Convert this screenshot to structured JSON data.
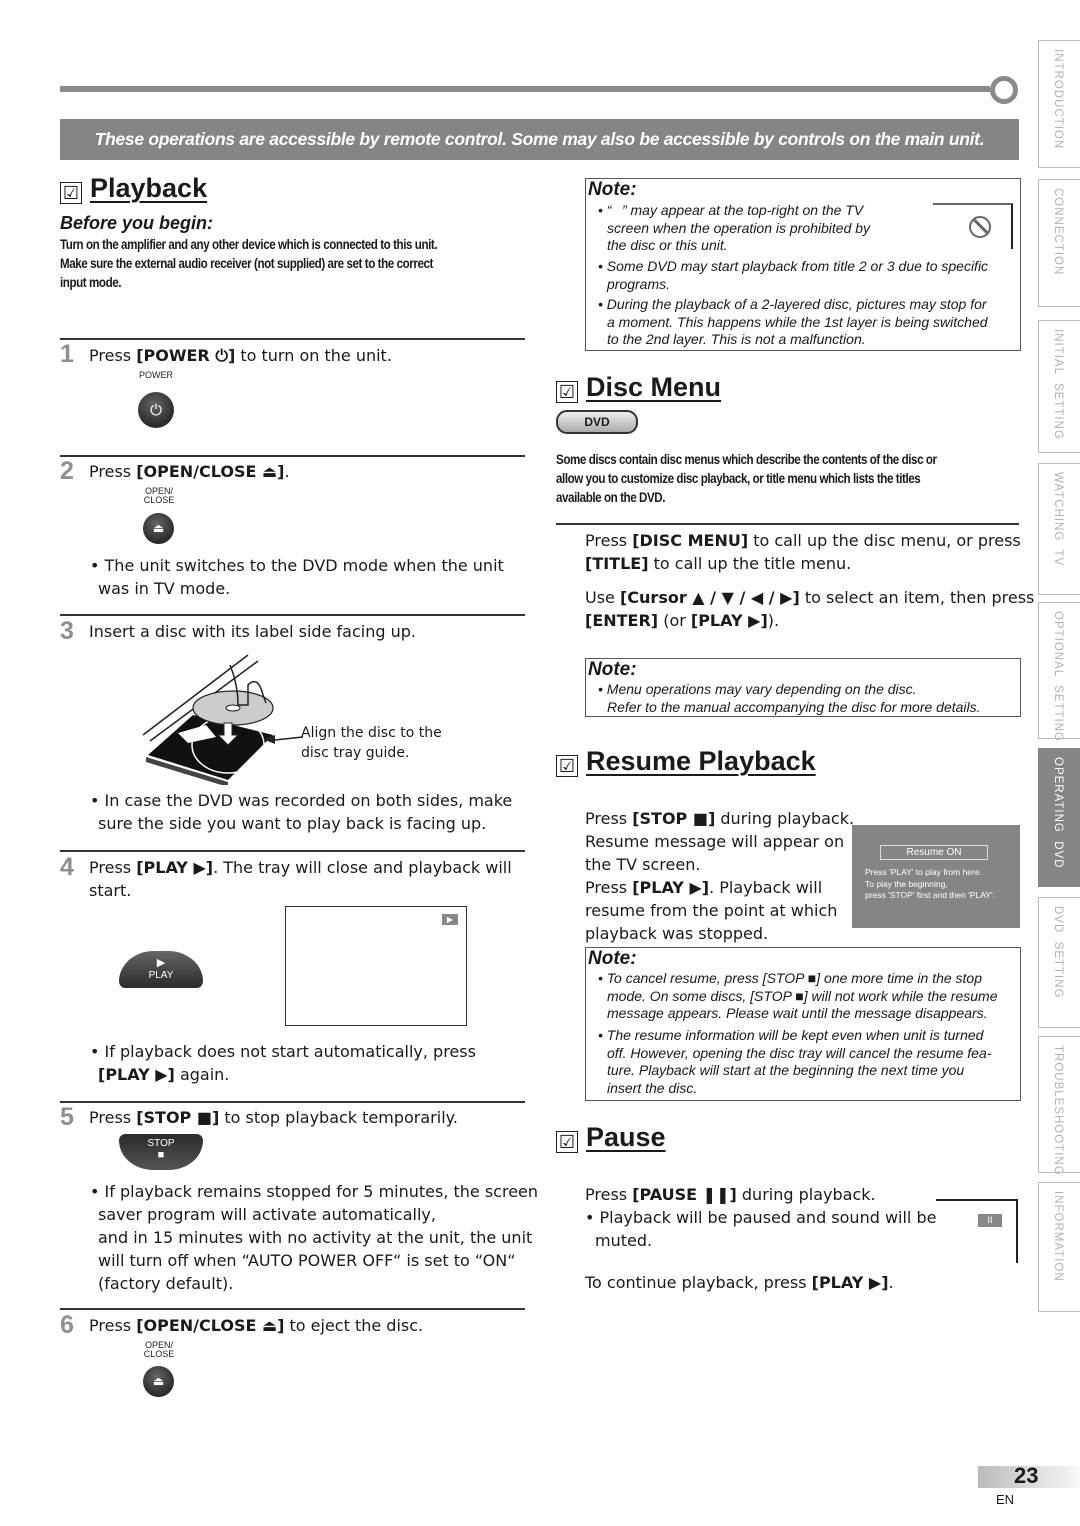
{
  "banner": "These operations are accessible by remote control. Some may also be accessible by controls on the main unit.",
  "side_tabs": [
    {
      "label": "INTRODUCTION",
      "active": false
    },
    {
      "label": "CONNECTION",
      "active": false
    },
    {
      "label": "INITIAL  SETTING",
      "active": false
    },
    {
      "label": "WATCHING  TV",
      "active": false
    },
    {
      "label": "OPTIONAL  SETTING",
      "active": false
    },
    {
      "label": "OPERATING  DVD",
      "active": true
    },
    {
      "label": "DVD  SETTING",
      "active": false
    },
    {
      "label": "TROUBLESHOOTING",
      "active": false
    },
    {
      "label": "INFORMATION",
      "active": false
    }
  ],
  "checkbox_glyph": "☑",
  "playback": {
    "title": "Playback",
    "before_you_begin": "Before you begin:",
    "before_text": [
      "Turn on the amplifier and any other device which is connected to this unit.",
      "Make sure the external audio receiver (not supplied) are set to the correct",
      "input mode."
    ],
    "steps": [
      {
        "num": "1",
        "pre": "Press ",
        "key": "[POWER ⏻]",
        "post": " to turn on the unit.",
        "button_label": "POWER",
        "button_icon": "⏻"
      },
      {
        "num": "2",
        "pre": "Press ",
        "key": "[OPEN/CLOSE ⏏]",
        "post": ".",
        "button_label_1": "OPEN/",
        "button_label_2": "CLOSE",
        "button_icon": "⏏",
        "bullet_1": "• The unit switches to the DVD mode when the unit",
        "bullet_2": "was in TV mode."
      },
      {
        "num": "3",
        "text": "Insert a disc with its label side facing up.",
        "callout_1": "Align the disc to the",
        "callout_2": "disc tray guide.",
        "bullet_1": "• In case the DVD was recorded on both sides, make",
        "bullet_2": "sure the side you want to play back is facing up."
      },
      {
        "num": "4",
        "pre": "Press ",
        "key": "[PLAY ▶]",
        "post": ". The tray will close and playback will",
        "line2": "start.",
        "button_label": "PLAY",
        "button_icon": "▶",
        "screen_icon": "▶",
        "bullet_1": "• If playback does not start automatically, press",
        "bullet_2_key": "[PLAY ▶]",
        "bullet_2_post": " again."
      },
      {
        "num": "5",
        "pre": "Press ",
        "key": "[STOP ■]",
        "post": " to stop playback temporarily.",
        "button_label": "STOP",
        "button_icon": "■",
        "bullet_lines": [
          "• If playback remains stopped for 5 minutes, the screen",
          "saver program will activate automatically,",
          "and in 15 minutes with no activity at the unit, the unit",
          "will turn off when “AUTO POWER OFF“ is set to “ON“",
          "(factory default)."
        ]
      },
      {
        "num": "6",
        "pre": "Press ",
        "key": "[OPEN/CLOSE ⏏]",
        "post": " to eject the disc.",
        "button_label_1": "OPEN/",
        "button_label_2": "CLOSE",
        "button_icon": "⏏"
      }
    ]
  },
  "note1": {
    "title": "Note:",
    "lines": [
      "• “⃠” may appear at the top-right on the TV",
      "screen when the operation is prohibited by",
      "the disc or this unit.",
      "• Some DVD may start playback from title 2 or 3 due to specific",
      "programs.",
      "• During the playback of a 2-layered disc, pictures may stop for",
      "a moment. This happens while the 1st layer is being switched",
      "to the 2nd layer. This is not a malfunction."
    ],
    "prohibited_icon": "⃠"
  },
  "disc_menu": {
    "title": "Disc Menu",
    "badge": "DVD",
    "intro": [
      "Some discs contain disc menus which describe the contents of the disc or",
      "allow you to customize disc playback, or title menu which lists the titles",
      "available on the DVD."
    ],
    "p1_key1": "[DISC MENU]",
    "p1_mid": " to call up the disc menu, or press",
    "p1_key2": "[TITLE]",
    "p1_end": " to call up the title menu.",
    "p2_pre": "Use ",
    "p2_key": "[Cursor ▲ / ▼ / ◀ / ▶]",
    "p2_mid": " to select an item, then press",
    "p2_key2": "[ENTER]",
    "p2_or": " (or ",
    "p2_key3": "[PLAY ▶]",
    "p2_end": ").",
    "press": "Press ",
    "note_title": "Note:",
    "note_lines": [
      "• Menu operations may vary depending on the disc.",
      "Refer to the manual accompanying the disc for more details."
    ]
  },
  "resume": {
    "title": "Resume Playback",
    "lines_pre": [
      "Press ",
      "Resume message will appear on",
      "the TV screen.",
      "Press ",
      "resume from the point at which",
      "playback was stopped."
    ],
    "key_stop": "[STOP ■]",
    "after_stop": " during playback.",
    "key_play": "[PLAY ▶]",
    "after_play": ". Playback will",
    "screen_title": "Resume ON",
    "screen_lines": [
      "Press 'PLAY' to play from here.",
      "To play the beginning,",
      "press 'STOP' first and then 'PLAY'."
    ],
    "note_title": "Note:",
    "note_lines": [
      "• To cancel resume, press [STOP ■] one more time in the stop",
      "mode. On some discs, [STOP ■] will not work while the resume",
      "message appears. Please wait until the message disappears.",
      "• The resume information will be kept even when unit is turned",
      "off. However, opening the disc tray will cancel the resume fea-",
      "ture. Playback will start at the beginning the next time you",
      "insert the disc."
    ]
  },
  "pause": {
    "title": "Pause",
    "press": "Press ",
    "key": "[PAUSE ❚❚]",
    "post": " during playback.",
    "bullet_1": "• Playback will be paused and sound will be",
    "bullet_2": "muted.",
    "continue_pre": "To continue playback, press ",
    "continue_key": "[PLAY ▶]",
    "continue_end": ".",
    "screen_icon": "II"
  },
  "footer": {
    "page": "23",
    "lang": "EN"
  }
}
